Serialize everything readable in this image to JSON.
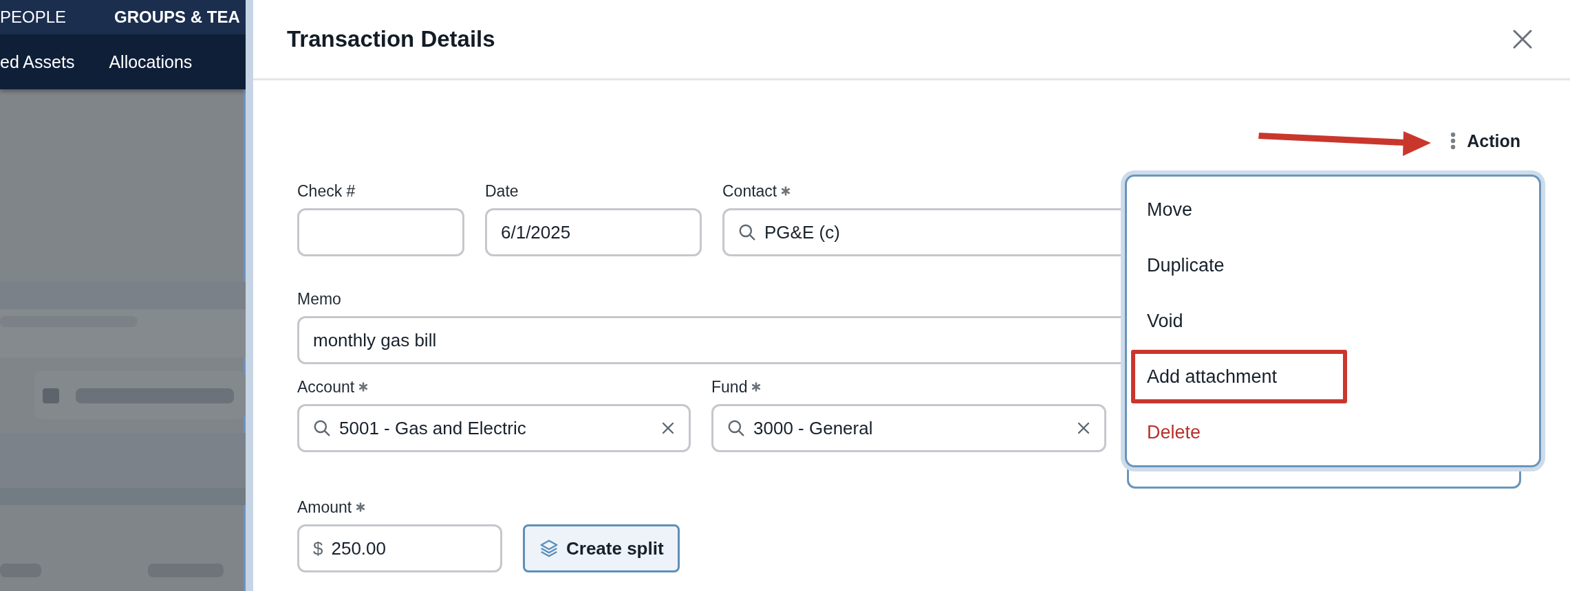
{
  "background": {
    "nav_tabs": [
      {
        "label": "PEOPLE",
        "selected": false
      },
      {
        "label": "GROUPS & TEA",
        "selected": true
      }
    ],
    "sub_tabs": [
      {
        "label": "ed Assets"
      },
      {
        "label": "Allocations"
      }
    ]
  },
  "dialog": {
    "title": "Transaction Details",
    "action_label": "Action",
    "rows": [
      {
        "fields": [
          {
            "label": "Check #",
            "required": false,
            "kind": "text"
          },
          {
            "label": "Date",
            "required": false,
            "kind": "text",
            "value": "6/1/2025"
          },
          {
            "label": "Contact",
            "required": true,
            "kind": "search",
            "value": "PG&E (c)"
          }
        ]
      },
      {
        "fields": [
          {
            "label": "Memo",
            "required": false,
            "kind": "text",
            "value": "monthly gas bill"
          }
        ]
      },
      {
        "fields": [
          {
            "label": "Account",
            "required": true,
            "kind": "search",
            "value": "5001 - Gas and Electric",
            "clearable": true
          },
          {
            "label": "Fund",
            "required": true,
            "kind": "search",
            "value": "3000 - General",
            "clearable": true
          },
          {
            "kind": "text",
            "focused": true
          }
        ]
      },
      {
        "fields": [
          {
            "label": "Amount",
            "required": true,
            "kind": "money",
            "prefix": "$",
            "value": "250.00"
          },
          {
            "kind": "button",
            "label": "Create split"
          }
        ]
      }
    ]
  },
  "action_menu": {
    "items": [
      {
        "label": "Move",
        "kind": "normal",
        "highlighted": false
      },
      {
        "label": "Duplicate",
        "kind": "normal",
        "highlighted": false
      },
      {
        "label": "Void",
        "kind": "normal",
        "highlighted": false
      },
      {
        "label": "Add attachment",
        "kind": "normal",
        "highlighted": true
      },
      {
        "label": "Delete",
        "kind": "danger",
        "highlighted": false
      }
    ]
  },
  "annotations": [
    {
      "kind": "arrow"
    }
  ]
}
